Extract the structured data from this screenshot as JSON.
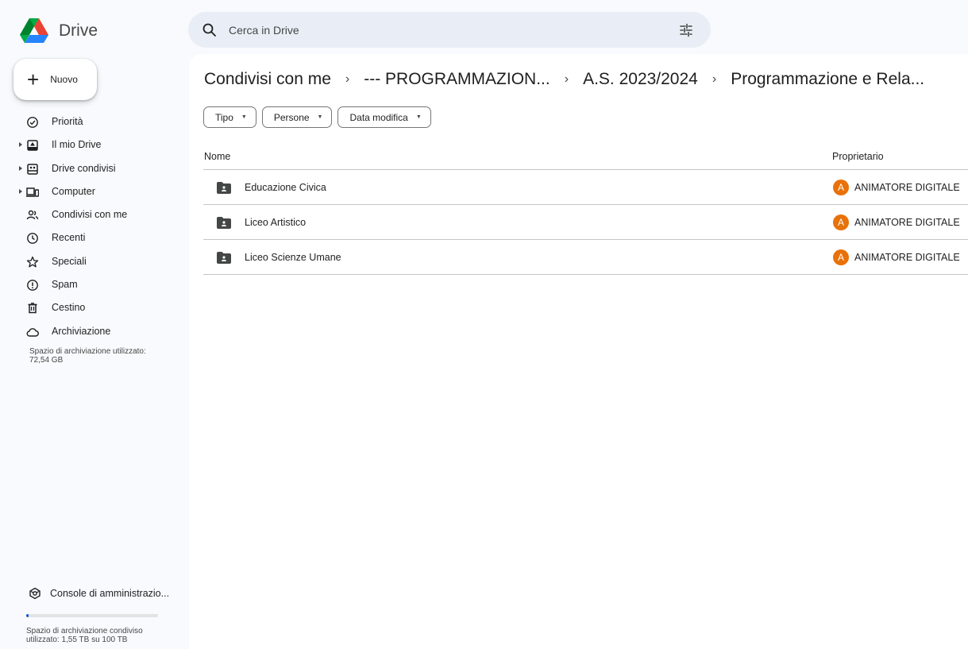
{
  "app": {
    "name": "Drive"
  },
  "search": {
    "placeholder": "Cerca in Drive"
  },
  "sidebar": {
    "new_label": "Nuovo",
    "items": [
      {
        "label": "Priorità",
        "icon": "check-circle-icon",
        "expandable": false
      },
      {
        "label": "Il mio Drive",
        "icon": "my-drive-icon",
        "expandable": true
      },
      {
        "label": "Drive condivisi",
        "icon": "shared-drives-icon",
        "expandable": true
      },
      {
        "label": "Computer",
        "icon": "computer-icon",
        "expandable": true
      },
      {
        "label": "Condivisi con me",
        "icon": "people-icon",
        "expandable": false
      },
      {
        "label": "Recenti",
        "icon": "clock-icon",
        "expandable": false
      },
      {
        "label": "Speciali",
        "icon": "star-icon",
        "expandable": false
      },
      {
        "label": "Spam",
        "icon": "spam-icon",
        "expandable": false
      },
      {
        "label": "Cestino",
        "icon": "trash-icon",
        "expandable": false
      },
      {
        "label": "Archiviazione",
        "icon": "cloud-icon",
        "expandable": false
      }
    ],
    "storage_text": "Spazio di archiviazione utilizzato: 72,54 GB",
    "admin_label": "Console di amministrazio...",
    "quota_fraction": 0.0155,
    "quota_text": "Spazio di archiviazione condiviso utilizzato: 1,55 TB su 100 TB"
  },
  "breadcrumb": [
    "Condivisi con me",
    "--- PROGRAMMAZION...",
    "A.S. 2023/2024",
    "Programmazione e Rela..."
  ],
  "filters": [
    "Tipo",
    "Persone",
    "Data modifica"
  ],
  "table": {
    "headers": {
      "name": "Nome",
      "owner": "Proprietario"
    },
    "rows": [
      {
        "name": "Educazione Civica",
        "owner": "ANIMATORE DIGITALE",
        "owner_initial": "A"
      },
      {
        "name": "Liceo Artistico",
        "owner": "ANIMATORE DIGITALE",
        "owner_initial": "A"
      },
      {
        "name": "Liceo Scienze Umane",
        "owner": "ANIMATORE DIGITALE",
        "owner_initial": "A"
      }
    ]
  },
  "colors": {
    "accent": "#0b57d0",
    "avatar": "#e8710a",
    "background": "#f8fafd",
    "search_bg": "#e9eef6"
  }
}
